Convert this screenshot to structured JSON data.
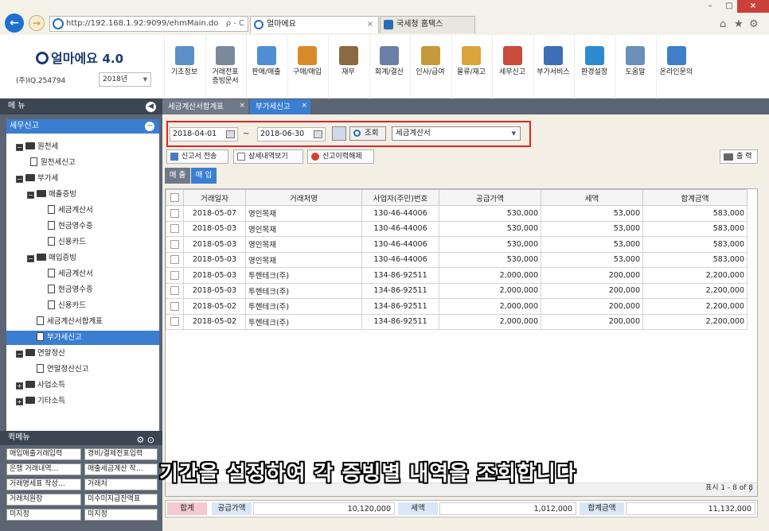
{
  "browser": {
    "url": "http://192.168.1.92:9099/ehmMain.do",
    "addr_controls": "ρ - C",
    "tabs": [
      {
        "label": "얼마에요",
        "close": "×"
      },
      {
        "label": "국세청 홈택스",
        "close": ""
      }
    ],
    "window_controls": {
      "min": "–",
      "max": "□",
      "close": "×"
    },
    "toolbar_icons": {
      "home": "⌂",
      "star": "★",
      "gear": "⚙"
    }
  },
  "app": {
    "logo_text": "얼마에요",
    "logo_version": "4.0",
    "company": "(주)IQ.254794",
    "year": "2018년",
    "menu": [
      {
        "label": "기초정보",
        "color": "#5b8fc7"
      },
      {
        "label": "거래전표\n증빙문서",
        "color": "#7a8a9a"
      },
      {
        "label": "판매/매출",
        "color": "#4f8fd4"
      },
      {
        "label": "구매/매입",
        "color": "#d98a2b"
      },
      {
        "label": "재무",
        "color": "#8a6a3e"
      },
      {
        "label": "회계/결산",
        "color": "#6c7fa6"
      },
      {
        "label": "인사/급여",
        "color": "#c69a3c"
      },
      {
        "label": "물류/재고",
        "color": "#d9a43a"
      },
      {
        "label": "세무신고",
        "color": "#c94b3b"
      },
      {
        "label": "부가서비스",
        "color": "#3d6fb4"
      },
      {
        "label": "환경설정",
        "color": "#2f8ad0"
      },
      {
        "label": "도움말",
        "color": "#6a8fb8"
      },
      {
        "label": "온라인문의",
        "color": "#3e7fc8"
      }
    ]
  },
  "sidebar": {
    "title": "메 뉴",
    "collapse_icon": "◀",
    "root": "세무신고",
    "root_icon": "−",
    "tree": [
      {
        "label": "원천세",
        "type": "folder"
      },
      {
        "label": "원천세신고",
        "type": "doc"
      },
      {
        "label": "부가세",
        "type": "folder"
      },
      {
        "label": "매출증빙",
        "type": "folder"
      },
      {
        "label": "세금계산서",
        "type": "doc"
      },
      {
        "label": "현금영수증",
        "type": "doc"
      },
      {
        "label": "신용카드",
        "type": "doc"
      },
      {
        "label": "매입증빙",
        "type": "folder"
      },
      {
        "label": "세금계산서",
        "type": "doc"
      },
      {
        "label": "현금영수증",
        "type": "doc"
      },
      {
        "label": "신용카드",
        "type": "doc"
      },
      {
        "label": "세금계산서합계표",
        "type": "doc"
      },
      {
        "label": "부가세신고",
        "type": "doc"
      },
      {
        "label": "연말정산",
        "type": "folder"
      },
      {
        "label": "연말정산신고",
        "type": "doc"
      },
      {
        "label": "사업소득",
        "type": "folder"
      },
      {
        "label": "기타소득",
        "type": "folder"
      }
    ],
    "toggle_open": "−",
    "toggle_closed": "+",
    "fav_title": "퀵메뉴",
    "fav_icons": "⚙ ⊙",
    "favorites": [
      "매입매출거래입력",
      "경비/결제전표입력",
      "은행 거래내역…",
      "매출세금계산 작…",
      "거래명세표 작성…",
      "거래처",
      "거래처원장",
      "미수미지급잔액표",
      "미지정",
      "미지정"
    ]
  },
  "content": {
    "tabs": [
      {
        "label": "세금계산서합계표",
        "close": "×"
      },
      {
        "label": "부가세신고",
        "close": "×"
      }
    ],
    "date_from": "2018-04-01",
    "date_to": "2018-06-30",
    "tilde": "~",
    "search_label": "조회",
    "doc_type": "세금계산서",
    "actions": [
      "신고서 전송",
      "상세내역보기",
      "신고이력해제"
    ],
    "print_label": "출 력",
    "subtabs": [
      "매 출",
      "매 입"
    ],
    "columns": [
      "거래일자",
      "거래처명",
      "사업자(주민)번호",
      "공급가액",
      "세액",
      "합계금액"
    ],
    "rows": [
      [
        "2018-05-07",
        "영인목재",
        "130-46-44006",
        "530,000",
        "53,000",
        "583,000"
      ],
      [
        "2018-05-03",
        "영인목재",
        "130-46-44006",
        "530,000",
        "53,000",
        "583,000"
      ],
      [
        "2018-05-03",
        "영인목재",
        "130-46-44006",
        "530,000",
        "53,000",
        "583,000"
      ],
      [
        "2018-05-03",
        "영인목재",
        "130-46-44006",
        "530,000",
        "53,000",
        "583,000"
      ],
      [
        "2018-05-03",
        "투헨테크(주)",
        "134-86-92511",
        "2,000,000",
        "200,000",
        "2,200,000"
      ],
      [
        "2018-05-03",
        "투헨테크(주)",
        "134-86-92511",
        "2,000,000",
        "200,000",
        "2,200,000"
      ],
      [
        "2018-05-02",
        "투헨테크(주)",
        "134-86-92511",
        "2,000,000",
        "200,000",
        "2,200,000"
      ],
      [
        "2018-05-02",
        "투헨테크(주)",
        "134-86-92511",
        "2,000,000",
        "200,000",
        "2,200,000"
      ]
    ],
    "scroll_right_icon": "›",
    "page_info": "표시 1 - 8 of 8",
    "totals": {
      "label": "합계",
      "supply_label": "공급가액",
      "supply_value": "10,120,000",
      "tax_label": "세액",
      "tax_value": "1,012,000",
      "total_label": "합계금액",
      "total_value": "11,132,000"
    }
  },
  "caption": "기간을 설정하여 각 증빙별 내역을 조회합니다"
}
